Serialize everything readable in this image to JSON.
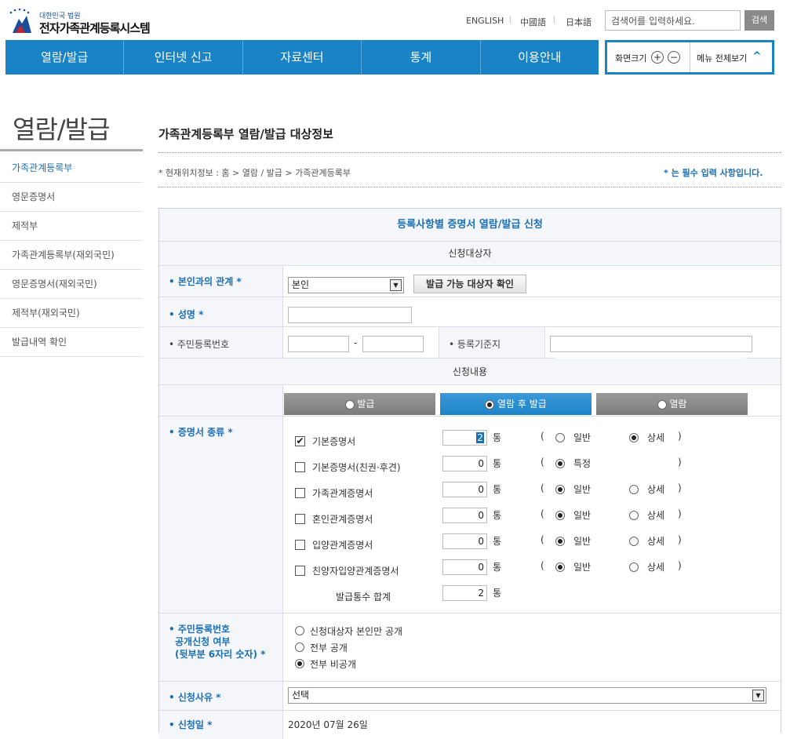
{
  "header": {
    "logo_small": "대한민국 법원",
    "logo_title": "전자가족관계등록시스템",
    "languages": [
      "ENGLISH",
      "中國語",
      "日本語"
    ],
    "search_placeholder": "검색어를 입력하세요.",
    "search_button": "검색"
  },
  "nav": {
    "items": [
      "열람/발급",
      "인터넷 신고",
      "자료센터",
      "통계",
      "이용안내"
    ],
    "zoom_label": "화면크기",
    "zoom_in": "+",
    "zoom_out": "−",
    "menu_all": "메뉴 전체보기",
    "accent": "#1a83c6"
  },
  "sidebar": {
    "title": "열람/발급",
    "items": [
      "가족관계등록부",
      "영문증명서",
      "제적부",
      "가족관계등록부(재외국민)",
      "영문증명서(재외국민)",
      "제적부(재외국민)",
      "발급내역 확인"
    ]
  },
  "main": {
    "page_title": "가족관계등록부 열람/발급 대상정보",
    "breadcrumb": "* 현재위치정보 : 홈 > 열람 / 발급 > 가족관계등록부",
    "required_note": "* 는 필수 입력 사항입니다.",
    "form_title": "등록사항별 증명서 열람/발급 신청",
    "section_target": "신청대상자",
    "relation_label": "• 본인과의 관계 *",
    "relation_value": "본인",
    "check_button": "발급 가능 대상자 확인",
    "name_label": "• 성명 *",
    "rrn_label": "• 주민등록번호",
    "rrn_dash": "-",
    "base_addr_label": "• 등록기준지",
    "section_content": "신청내용",
    "tabs": [
      "발급",
      "열람 후 발급",
      "열람"
    ],
    "cert_type_label": "• 증명서 종류 *",
    "unit": "통",
    "paren_open": "(",
    "paren_close": ")",
    "certs": [
      {
        "name": "기본증명서",
        "checked": "✔",
        "qty": "2",
        "opt1": "일반",
        "opt2": "상세"
      },
      {
        "name": "기본증명서(친권·후견)",
        "checked": "",
        "qty": "0",
        "opt1": "특정",
        "opt2": ""
      },
      {
        "name": "가족관계증명서",
        "checked": "",
        "qty": "0",
        "opt1": "일반",
        "opt2": "상세"
      },
      {
        "name": "혼인관계증명서",
        "checked": "",
        "qty": "0",
        "opt1": "일반",
        "opt2": "상세"
      },
      {
        "name": "입양관계증명서",
        "checked": "",
        "qty": "0",
        "opt1": "일반",
        "opt2": "상세"
      },
      {
        "name": "친양자입양관계증명서",
        "checked": "",
        "qty": "0",
        "opt1": "일반",
        "opt2": "상세"
      }
    ],
    "total_label": "발급통수 합계",
    "total_qty": "2",
    "rrn_disclose_label_1": "• 주민등록번호",
    "rrn_disclose_label_2": "공개신청 여부",
    "rrn_disclose_label_3": "(뒷부분 6자리 숫자) *",
    "disclose_options": [
      "신청대상자 본인만 공개",
      "전부 공개",
      "전부 비공개"
    ],
    "reason_label": "• 신청사유 *",
    "reason_value": "선택",
    "date_label": "• 신청일 *",
    "date_value": "2020년 07월 26일"
  }
}
